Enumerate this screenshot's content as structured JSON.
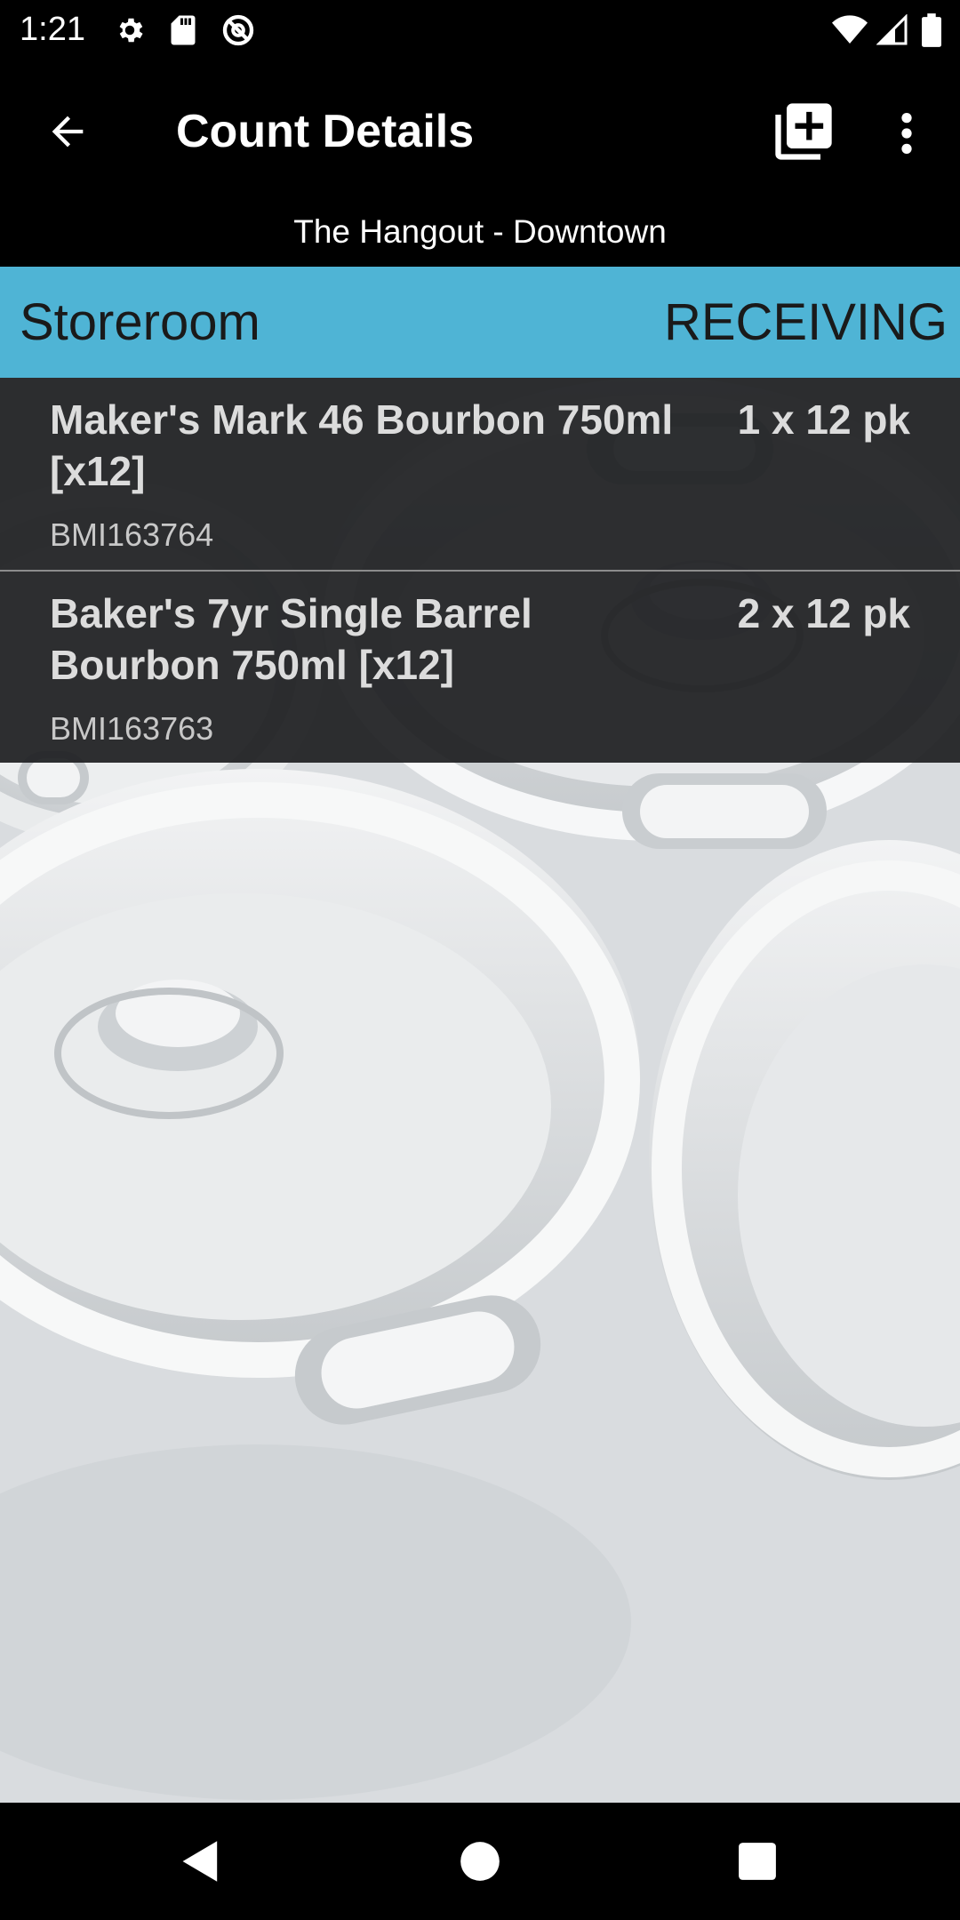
{
  "status_bar": {
    "time": "1:21",
    "icons": [
      "settings-icon",
      "sd-card-icon",
      "no-tracking-icon",
      "wifi-icon",
      "signal-icon",
      "battery-icon"
    ]
  },
  "app_bar": {
    "title": "Count Details",
    "subtitle": "The Hangout - Downtown",
    "icons": [
      "back-arrow-icon",
      "add-item-icon",
      "more-vert-icon"
    ]
  },
  "section": {
    "location": "Storeroom",
    "mode": "RECEIVING",
    "color": "#4fb4d5"
  },
  "items": [
    {
      "name": "Maker's Mark 46 Bourbon 750ml [x12]",
      "quantity": "1 x 12 pk",
      "code": "BMI163764"
    },
    {
      "name": "Baker's 7yr Single Barrel Bourbon 750ml [x12]",
      "quantity": "2 x 12 pk",
      "code": "BMI163763"
    }
  ],
  "nav_bar": {
    "icons": [
      "back-triangle-icon",
      "home-circle-icon",
      "recents-square-icon"
    ]
  }
}
